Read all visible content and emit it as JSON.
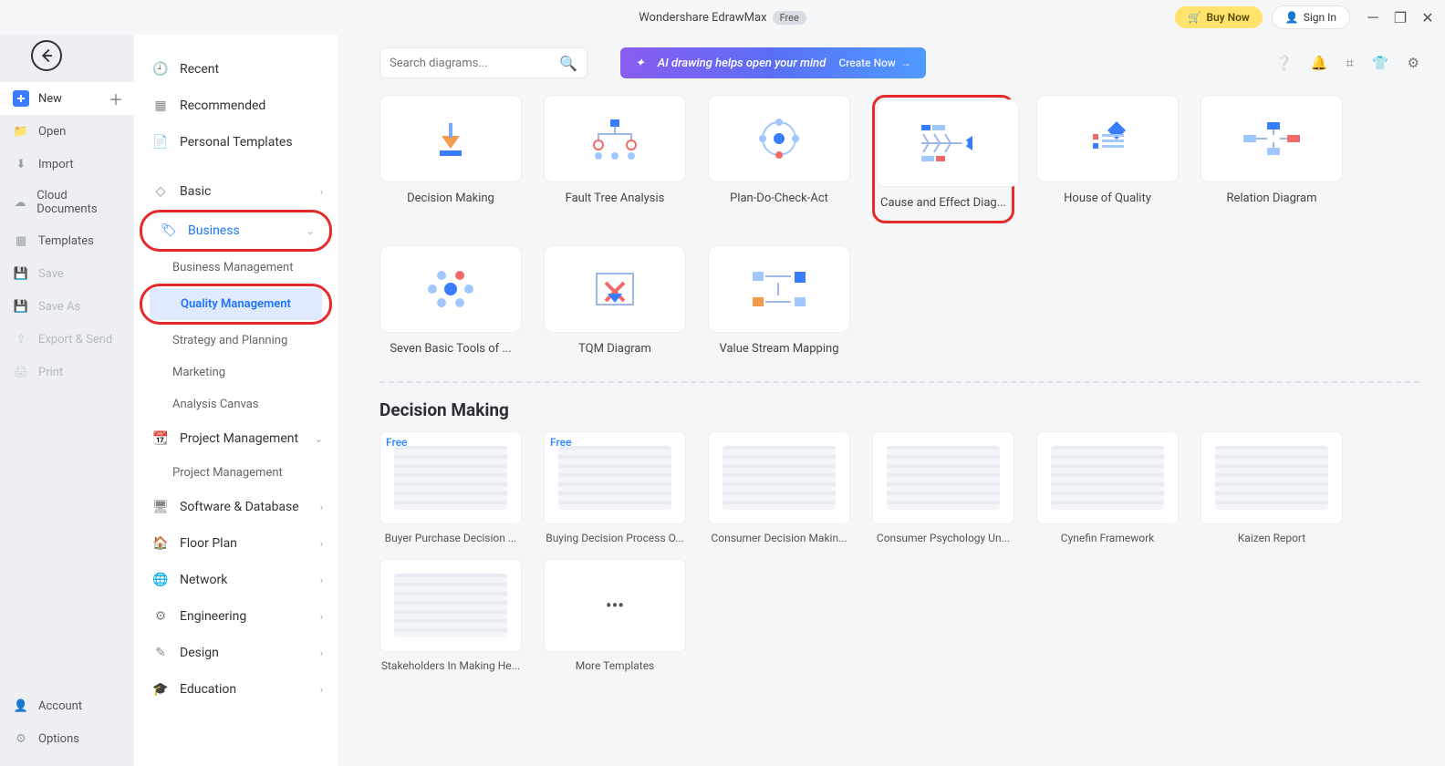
{
  "titlebar": {
    "app": "Wondershare EdrawMax",
    "tag": "Free",
    "buy": "Buy Now",
    "signin": "Sign In"
  },
  "rail": {
    "new": "New",
    "open": "Open",
    "import": "Import",
    "cloud": "Cloud Documents",
    "templates": "Templates",
    "save": "Save",
    "saveas": "Save As",
    "export": "Export & Send",
    "print": "Print",
    "account": "Account",
    "options": "Options"
  },
  "sb2": {
    "recent": "Recent",
    "recommended": "Recommended",
    "personal": "Personal Templates",
    "basic": "Basic",
    "business": "Business",
    "business_sub": {
      "mgmt": "Business Management",
      "quality": "Quality Management",
      "strategy": "Strategy and Planning",
      "marketing": "Marketing",
      "analysis": "Analysis Canvas"
    },
    "projmgmt": "Project Management",
    "projmgmt_sub": "Project Management",
    "software": "Software & Database",
    "floor": "Floor Plan",
    "network": "Network",
    "engineering": "Engineering",
    "design": "Design",
    "education": "Education"
  },
  "search": {
    "placeholder": "Search diagrams..."
  },
  "banner": {
    "text": "AI drawing helps open your mind",
    "cta": "Create Now"
  },
  "templates": [
    "Decision Making",
    "Fault Tree Analysis",
    "Plan-Do-Check-Act",
    "Cause and Effect Diag...",
    "House of Quality",
    "Relation Diagram",
    "Seven Basic Tools of ...",
    "TQM Diagram",
    "Value Stream Mapping"
  ],
  "section_title": "Decision Making",
  "examples_row1": [
    {
      "title": "Buyer Purchase Decision ...",
      "free": true
    },
    {
      "title": "Buying Decision Process O...",
      "free": true
    },
    {
      "title": "Consumer Decision Makin...",
      "free": false
    },
    {
      "title": "Consumer Psychology Un...",
      "free": false
    },
    {
      "title": "Cynefin Framework",
      "free": false
    },
    {
      "title": "Kaizen Report",
      "free": false
    }
  ],
  "examples_row2": [
    {
      "title": "Stakeholders In Making He...",
      "free": false
    },
    {
      "title": "More Templates",
      "free": false,
      "more": true
    }
  ],
  "free_label": "Free"
}
